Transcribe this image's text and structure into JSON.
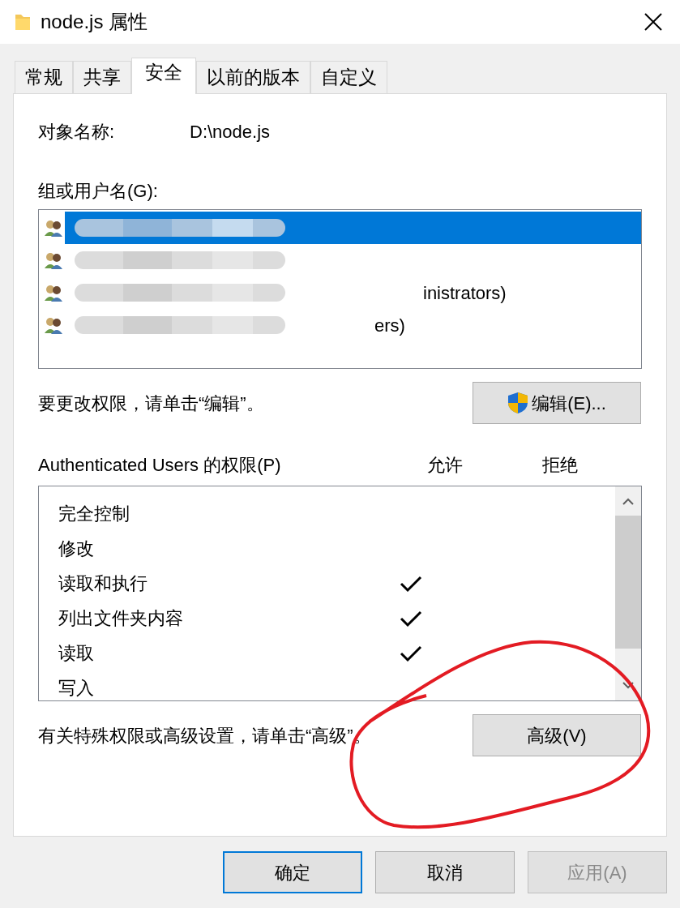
{
  "window": {
    "title": "node.js 属性"
  },
  "tabs": [
    {
      "label": "常规",
      "selected": false
    },
    {
      "label": "共享",
      "selected": false
    },
    {
      "label": "安全",
      "selected": true
    },
    {
      "label": "以前的版本",
      "selected": false
    },
    {
      "label": "自定义",
      "selected": false
    }
  ],
  "object_name": {
    "label": "对象名称:",
    "value": "D:\\node.js"
  },
  "groups": {
    "label": "组或用户名(G):",
    "items": [
      {
        "selected": true,
        "redacted": true
      },
      {
        "selected": false,
        "redacted": true
      },
      {
        "selected": false,
        "redacted": true,
        "text": "inistrators)"
      },
      {
        "selected": false,
        "redacted": true,
        "text": "ers)"
      }
    ]
  },
  "edit_hint": "要更改权限，请单击“编辑”。",
  "edit_button": "编辑(E)...",
  "permissions": {
    "label": "Authenticated Users 的权限(P)",
    "allow_header": "允许",
    "deny_header": "拒绝",
    "rows": [
      {
        "name": "完全控制",
        "allow": false,
        "deny": false
      },
      {
        "name": "修改",
        "allow": false,
        "deny": false
      },
      {
        "name": "读取和执行",
        "allow": true,
        "deny": false
      },
      {
        "name": "列出文件夹内容",
        "allow": true,
        "deny": false
      },
      {
        "name": "读取",
        "allow": true,
        "deny": false
      },
      {
        "name": "写入",
        "allow": false,
        "deny": false
      }
    ]
  },
  "advanced_hint": "有关特殊权限或高级设置，请单击“高级”。",
  "advanced_button": "高级(V)",
  "buttons": [
    {
      "label": "确定",
      "disabled": false,
      "default": true
    },
    {
      "label": "取消",
      "disabled": false,
      "default": false
    },
    {
      "label": "应用(A)",
      "disabled": true,
      "default": false
    }
  ]
}
